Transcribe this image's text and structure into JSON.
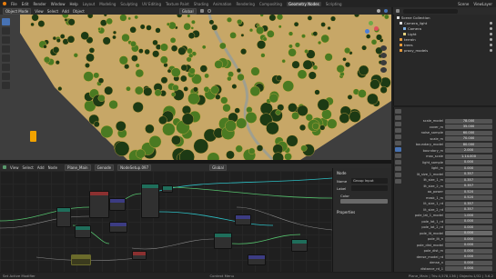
{
  "topbar": {
    "menus": [
      "File",
      "Edit",
      "Render",
      "Window",
      "Help"
    ],
    "workspaces": [
      "Layout",
      "Modeling",
      "Sculpting",
      "UV Editing",
      "Texture Paint",
      "Shading",
      "Animation",
      "Rendering",
      "Compositing",
      "Geometry Nodes",
      "Scripting"
    ],
    "active_workspace": "Geometry Nodes",
    "scene": "Scene",
    "view_layer": "ViewLayer"
  },
  "viewport_header": {
    "mode": "Object Mode",
    "menus": [
      "View",
      "Select",
      "Add",
      "Object"
    ],
    "orientation": "Global"
  },
  "node_header": {
    "menus": [
      "View",
      "Select",
      "Add",
      "Node"
    ],
    "object": "Plane_Main",
    "modifier": "Genode",
    "node_tree": "NodeSetup.097",
    "overlay_label": "Global"
  },
  "npanel": {
    "tab_label": "Node",
    "name_label": "Name",
    "name_value": "Group Input",
    "label_label": "Label",
    "color_label": "Color",
    "properties_label": "Properties"
  },
  "outliner": {
    "title": "Scene Collection",
    "items": [
      {
        "label": "Scene Collection",
        "color": "#dddddd"
      },
      {
        "label": "Camera_light",
        "color": "#dddddd"
      },
      {
        "label": "Camera",
        "color": "#dddddd"
      },
      {
        "label": "Light",
        "color": "#dddddd"
      },
      {
        "label": "terrain",
        "color": "#e79b3b"
      },
      {
        "label": "trees",
        "color": "#e79b3b"
      },
      {
        "label": "proxy_models",
        "color": "#e79b3b"
      }
    ]
  },
  "properties": {
    "rows": [
      {
        "label": "scale_model",
        "value": "78.000"
      },
      {
        "label": "cover_m",
        "value": "35.000"
      },
      {
        "label": "noise_sample",
        "value": "60.000"
      },
      {
        "label": "scale_m",
        "value": "70.000"
      },
      {
        "label": "boundary_model",
        "value": "80.000"
      },
      {
        "label": "boundary_m",
        "value": "2.000"
      },
      {
        "label": "max_scale",
        "value": "1.14.000"
      },
      {
        "label": "light_sample",
        "value": "0.000"
      },
      {
        "label": "light_m",
        "value": "0.000"
      },
      {
        "label": "lit_size_1_model",
        "value": "0.357"
      },
      {
        "label": "lit_size_1_m",
        "value": "0.357"
      },
      {
        "label": "lit_size_2_m",
        "value": "0.357"
      },
      {
        "label": "ao_power",
        "value": "0.520"
      },
      {
        "label": "mask_1_m",
        "value": "0.520"
      },
      {
        "label": "lit_size_1_rd",
        "value": "0.357"
      },
      {
        "label": "lit_size_2_rd",
        "value": "0.357"
      },
      {
        "label": "pole_lat_1_model",
        "value": "1.000"
      },
      {
        "label": "pole_lat_1_rd",
        "value": "0.000"
      },
      {
        "label": "pole_lat_2_rd",
        "value": "0.000"
      },
      {
        "label": "pole_lit_model",
        "value": "0.000"
      },
      {
        "label": "pole_lit_n",
        "value": "0.000"
      },
      {
        "label": "pole_dist_model",
        "value": "0.000"
      },
      {
        "label": "pole_dist_m",
        "value": "0.000"
      },
      {
        "label": "dense_model_rd",
        "value": "0.000"
      },
      {
        "label": "dense_n",
        "value": "0.000"
      },
      {
        "label": "distance_rd_1",
        "value": "0.000"
      }
    ],
    "highlighted_index": 19
  },
  "statusbar": {
    "left": "Set Active Modifier",
    "middle": "Context Menu",
    "right": "Plane_Main | Tris:4,578,136 | Objects:1/32 | 3.6.2"
  },
  "colors": {
    "accent": "#4772b3",
    "ground": "#c9a96b",
    "tree_dark": "#1d3a14",
    "tree_light": "#4a7a22",
    "node_header_geometry": "#1f6e5b",
    "node_header_input": "#8b3030",
    "node_header_utility": "#3c3c83",
    "link_green": "#55c16d",
    "link_cyan": "#2dbfc4"
  }
}
